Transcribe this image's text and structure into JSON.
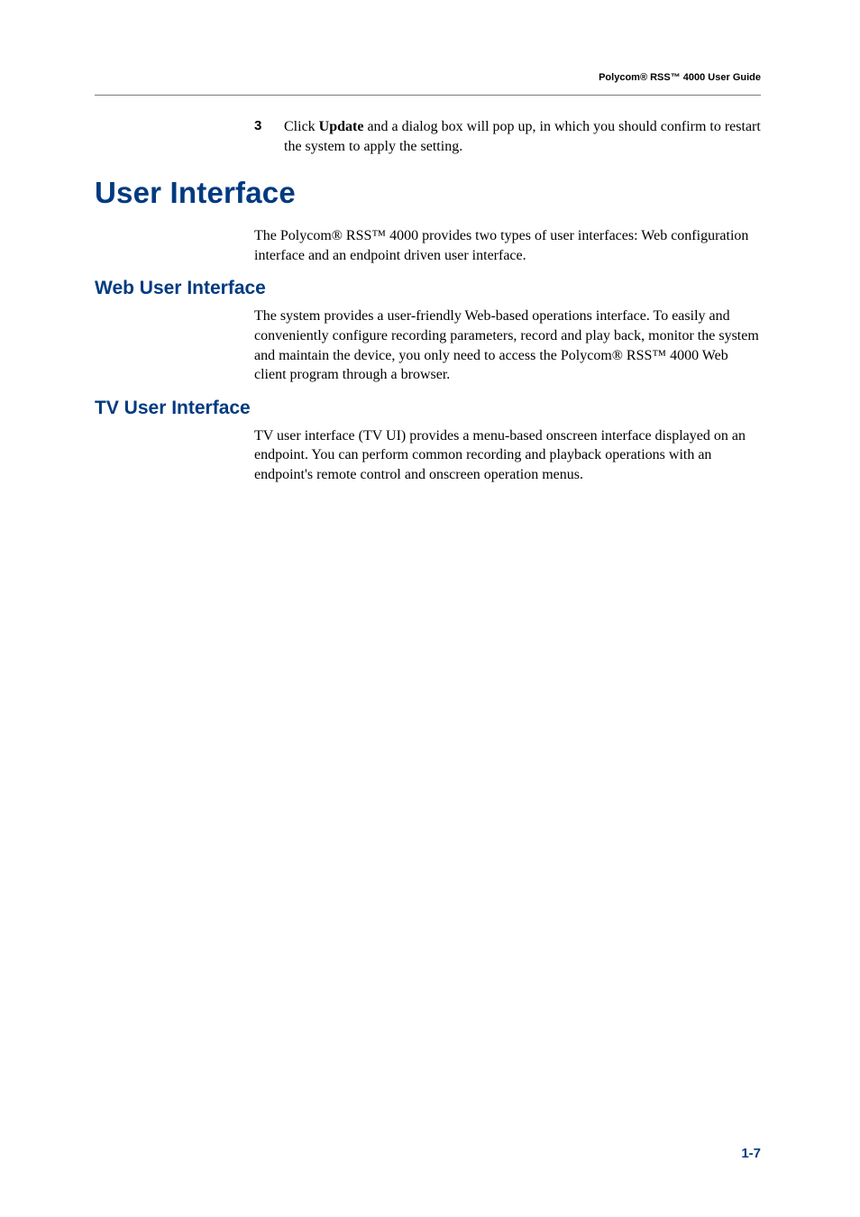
{
  "header": {
    "title": "Polycom® RSS™ 4000 User Guide"
  },
  "step": {
    "number": "3",
    "text_before": "Click ",
    "bold": "Update",
    "text_after": " and a dialog box will pop up, in which you should confirm to restart the system to apply the setting."
  },
  "h1": "User Interface",
  "intro": "The Polycom® RSS™ 4000 provides two types of user interfaces: Web configuration interface and an endpoint driven user interface.",
  "section1": {
    "heading": "Web User Interface",
    "body": "The system provides a user-friendly Web-based operations interface. To easily and conveniently configure recording parameters, record and play back, monitor the system and maintain the device, you only need to access the Polycom® RSS™ 4000 Web client program through a browser."
  },
  "section2": {
    "heading": "TV User Interface",
    "body": "TV user interface (TV UI) provides a menu-based onscreen interface displayed on an endpoint. You can perform common recording and playback operations with an endpoint's remote control and onscreen operation menus."
  },
  "page_number": "1-7"
}
